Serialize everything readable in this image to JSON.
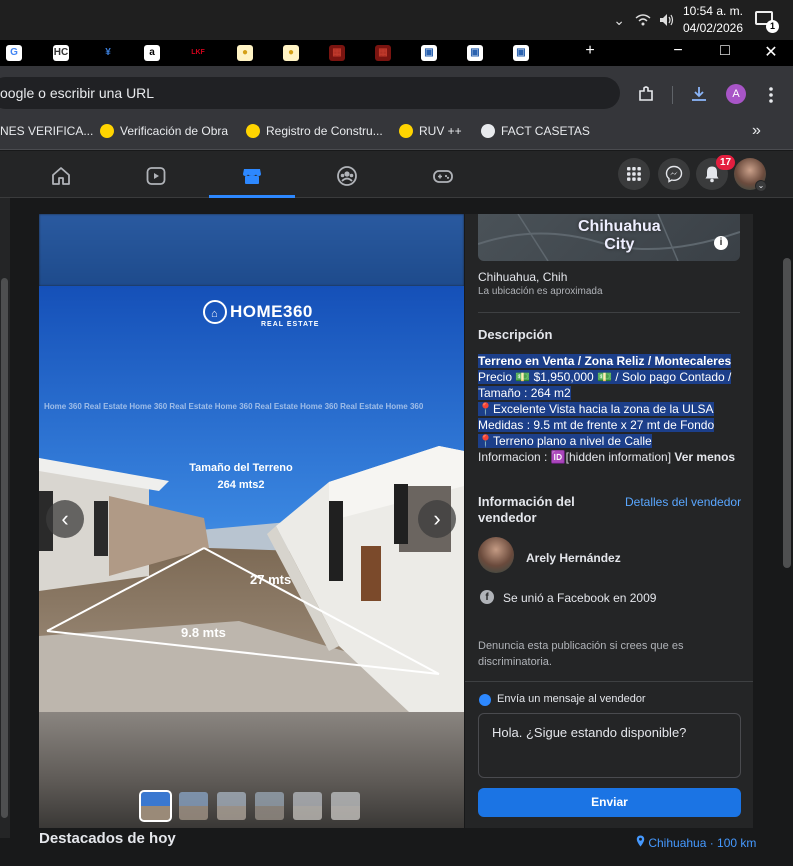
{
  "system": {
    "time": "10:54 a. m.",
    "date": "04/02/2026",
    "notification_count": "1"
  },
  "browser": {
    "address_text": "oogle o escribir una URL",
    "profile_initial": "A",
    "new_tab": "+",
    "win_min": "−",
    "win_max": "□",
    "win_close": "✕",
    "bookmarks": [
      {
        "label": "NES VERIFICA...",
        "color": "#00000000"
      },
      {
        "label": "Verificación de Obra",
        "color": "#ffd400"
      },
      {
        "label": "Registro de Constru...",
        "color": "#ffd400"
      },
      {
        "label": "RUV ++",
        "color": "#ffd400"
      },
      {
        "label": "FACT CASETAS",
        "color": "#e8eaed"
      }
    ],
    "more_bookmarks": "»",
    "tab_favicons": [
      {
        "glyph": "G",
        "color": "#4285f4",
        "bg": "#ffffff"
      },
      {
        "glyph": "HC",
        "color": "#333",
        "bg": "#ffffff"
      },
      {
        "glyph": "¥",
        "color": "#3b7dd8",
        "bg": "#000000"
      },
      {
        "glyph": "a",
        "color": "#000",
        "bg": "#ffffff"
      },
      {
        "glyph": "LKF",
        "color": "#d0021b",
        "bg": "#000000"
      },
      {
        "glyph": "●",
        "color": "#d4a017",
        "bg": "#fff3c4"
      },
      {
        "glyph": "●",
        "color": "#d4a017",
        "bg": "#fff3c4"
      },
      {
        "glyph": "▦",
        "color": "#c0392b",
        "bg": "#7a1410"
      },
      {
        "glyph": "▦",
        "color": "#c0392b",
        "bg": "#7a1410"
      },
      {
        "glyph": "▣",
        "color": "#2b63b0",
        "bg": "#ffffff"
      },
      {
        "glyph": "▣",
        "color": "#2b63b0",
        "bg": "#ffffff"
      },
      {
        "glyph": "▣",
        "color": "#2b63b0",
        "bg": "#ffffff"
      }
    ]
  },
  "facebook": {
    "notifications_badge": "17"
  },
  "listing": {
    "photo": {
      "brand": "HOME360",
      "brand_sub": "REAL ESTATE",
      "watermark": "Home 360 Real Estate  Home 360 Real Estate  Home 360 Real Estate  Home 360 Real Estate  Home 360",
      "caption_line1": "Tamaño del Terreno",
      "caption_line2": "264 mts2",
      "depth_label": "27 mts",
      "front_label": "9.8 mts"
    },
    "map_label_line1": "Chihuahua",
    "map_label_line2": "City",
    "location": "Chihuahua, Chih",
    "location_note": "La ubicación es aproximada",
    "description_heading": "Descripción",
    "description_lines": [
      "Terreno en Venta / Zona Reliz / Montecaleres",
      "Precio 💵 $1,950,000 💵 / Solo pago Contado /",
      "Tamaño : 264 m2",
      "📍Excelente Vista hacia la zona de la ULSA",
      "Medidas : 9.5 mt de frente x 27 mt de Fondo",
      "📍Terreno plano a nivel de Calle",
      "Informacion : 🆔[hidden information]"
    ],
    "see_less": "Ver menos",
    "seller_heading_line1": "Información del",
    "seller_heading_line2": "vendedor",
    "seller_details_link": "Detalles del vendedor",
    "seller_name": "Arely Hernández",
    "seller_joined": "Se unió a Facebook en 2009",
    "report_line1": "Denuncia esta publicación si crees que es",
    "report_line2": "discriminatoria.",
    "message_heading": "Envía un mensaje al vendedor",
    "message_text": "Hola. ¿Sigue estando disponible?",
    "send_label": "Enviar"
  },
  "footer": {
    "title": "Destacados de hoy",
    "location": "Chihuahua · 100 km"
  }
}
